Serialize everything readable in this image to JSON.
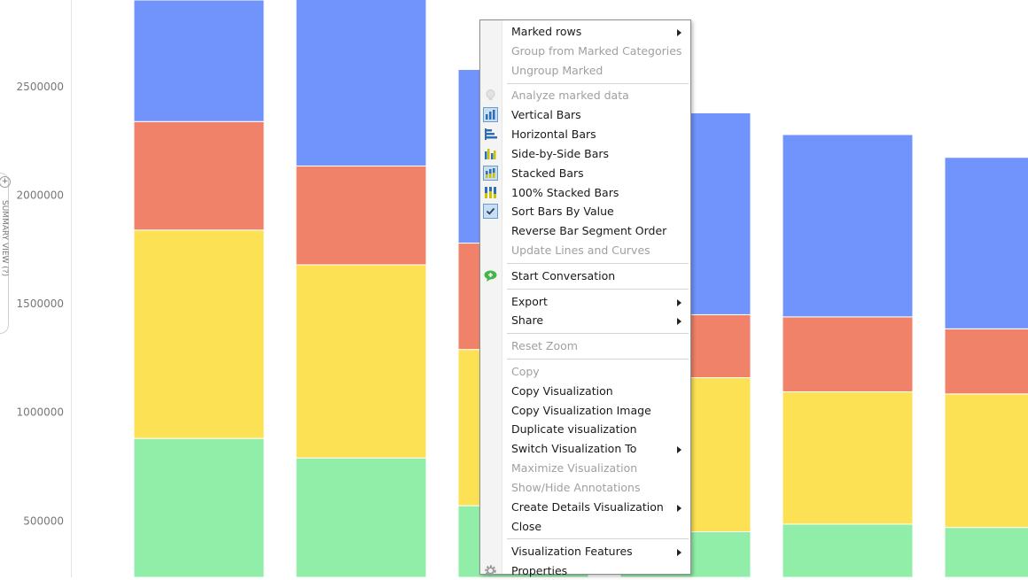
{
  "chart_data": {
    "type": "bar",
    "stacked": true,
    "categories": [
      "",
      "",
      "",
      "",
      "",
      ""
    ],
    "ylim": [
      240000,
      2900000
    ],
    "yticks": [
      500000,
      1000000,
      1500000,
      2000000,
      2500000
    ],
    "ytick_labels": [
      "500000",
      "1000000",
      "1500000",
      "2000000",
      "2500000"
    ],
    "grid": false,
    "series": [
      {
        "color": "#90EEA8",
        "values": [
          880000,
          790000,
          570000,
          450000,
          485000,
          470000
        ]
      },
      {
        "color": "#FCE154",
        "values": [
          960000,
          890000,
          720000,
          710000,
          610000,
          615000
        ]
      },
      {
        "color": "#F0826A",
        "values": [
          500000,
          455000,
          490000,
          290000,
          345000,
          300000
        ]
      },
      {
        "color": "#7094FC",
        "values": [
          560000,
          810000,
          800000,
          930000,
          840000,
          790000
        ]
      }
    ]
  },
  "side_panel": {
    "label": "SUMMARY VIEW (?)",
    "plus": "+"
  },
  "context_menu": {
    "items": [
      {
        "label": "Marked rows",
        "disabled": false,
        "submenu": true,
        "icon": ""
      },
      {
        "label": "Group from Marked Categories",
        "disabled": true,
        "submenu": false,
        "icon": ""
      },
      {
        "label": "Ungroup Marked",
        "disabled": true,
        "submenu": false,
        "icon": ""
      },
      {
        "separator": true
      },
      {
        "label": "Analyze marked data",
        "disabled": true,
        "submenu": false,
        "icon": "lightbulb-icon"
      },
      {
        "label": "Vertical Bars",
        "disabled": false,
        "submenu": false,
        "icon": "vertical-bars-icon"
      },
      {
        "label": "Horizontal Bars",
        "disabled": false,
        "submenu": false,
        "icon": "horizontal-bars-icon"
      },
      {
        "label": "Side-by-Side Bars",
        "disabled": false,
        "submenu": false,
        "icon": "side-by-side-bars-icon"
      },
      {
        "label": "Stacked Bars",
        "disabled": false,
        "submenu": false,
        "icon": "stacked-bars-icon"
      },
      {
        "label": "100% Stacked Bars",
        "disabled": false,
        "submenu": false,
        "icon": "percent-stacked-bars-icon"
      },
      {
        "label": "Sort Bars By Value",
        "disabled": false,
        "submenu": false,
        "icon": "checkmark-icon"
      },
      {
        "label": "Reverse Bar Segment Order",
        "disabled": false,
        "submenu": false,
        "icon": ""
      },
      {
        "label": "Update Lines and Curves",
        "disabled": true,
        "submenu": false,
        "icon": ""
      },
      {
        "separator": true
      },
      {
        "label": "Start Conversation",
        "disabled": false,
        "submenu": false,
        "icon": "conversation-icon"
      },
      {
        "separator": true
      },
      {
        "label": "Export",
        "disabled": false,
        "submenu": true,
        "icon": ""
      },
      {
        "label": "Share",
        "disabled": false,
        "submenu": true,
        "icon": ""
      },
      {
        "separator": true
      },
      {
        "label": "Reset Zoom",
        "disabled": true,
        "submenu": false,
        "icon": ""
      },
      {
        "separator": true
      },
      {
        "label": "Copy",
        "disabled": true,
        "submenu": false,
        "icon": ""
      },
      {
        "label": "Copy Visualization",
        "disabled": false,
        "submenu": false,
        "icon": ""
      },
      {
        "label": "Copy Visualization Image",
        "disabled": false,
        "submenu": false,
        "icon": ""
      },
      {
        "label": "Duplicate visualization",
        "disabled": false,
        "submenu": false,
        "icon": ""
      },
      {
        "label": "Switch Visualization To",
        "disabled": false,
        "submenu": true,
        "icon": ""
      },
      {
        "label": "Maximize Visualization",
        "disabled": true,
        "submenu": false,
        "icon": ""
      },
      {
        "label": "Show/Hide Annotations",
        "disabled": true,
        "submenu": false,
        "icon": ""
      },
      {
        "label": "Create Details Visualization",
        "disabled": false,
        "submenu": true,
        "icon": ""
      },
      {
        "label": "Close",
        "disabled": false,
        "submenu": false,
        "icon": ""
      },
      {
        "separator": true
      },
      {
        "label": "Visualization Features",
        "disabled": false,
        "submenu": true,
        "icon": ""
      },
      {
        "label": "Properties",
        "disabled": false,
        "submenu": false,
        "icon": "gear-icon"
      }
    ]
  }
}
